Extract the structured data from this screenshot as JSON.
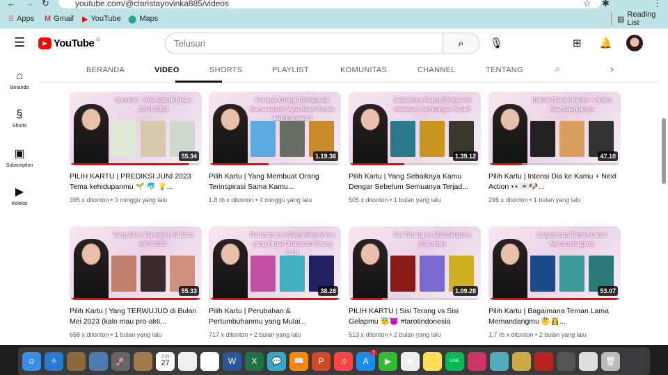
{
  "browser": {
    "url": "youtube.com/@claristayovinka885/videos",
    "bookmarks": [
      "Apps",
      "Gmail",
      "YouTube",
      "Maps"
    ],
    "reading_list": "Reading List"
  },
  "header": {
    "logo": "YouTube",
    "region": "ID",
    "search_placeholder": "Telusuri"
  },
  "sidebar": [
    {
      "label": "Beranda",
      "icon": "home-icon"
    },
    {
      "label": "Shorts",
      "icon": "shorts-icon"
    },
    {
      "label": "Subscription",
      "icon": "subscriptions-icon"
    },
    {
      "label": "Koleksi",
      "icon": "library-icon"
    }
  ],
  "tabs": [
    "BERANDA",
    "VIDEO",
    "SHORTS",
    "PLAYLIST",
    "KOMUNITAS",
    "CHANNEL",
    "TENTANG"
  ],
  "videos": [
    {
      "thumb_text": "Summer · Ada Apa di Bulan JUNI 2023",
      "duration": "55.34",
      "progress": 0.9,
      "title": "PILIH KARTU | PREDIKSI JUNI 2023 Tema kehidupanmu 🌱 🐬 💡...",
      "views": "395 x ditonton",
      "age": "3 minggu yang lalu",
      "pics": [
        "#dfe8d5",
        "#d8c8b0",
        "#cfd8cf"
      ]
    },
    {
      "thumb_text": "Kenapa Orang Terinspirasi Sama kamu? Apa Betul Sudah Jadi Inspirasi?",
      "duration": "1.19.36",
      "progress": 0.45,
      "title": "Pilih Kartu | Yang Membuat Orang Terinspirasi Sama Kamu...",
      "views": "1,8 rb x ditonton",
      "age": "4 minggu yang lalu",
      "pics": [
        "#5aa9e0",
        "#6a6f66",
        "#c88a2c"
      ]
    },
    {
      "thumb_text": "Sebaiknya Kamu Dengar Ini Sebelum Semuanya Terjadi",
      "duration": "1.39.12",
      "progress": 0.42,
      "title": "Pilih Kartu | Yang Sebaiknya Kamu Dengar Sebelum Semuanya Terjad...",
      "views": "505 x ditonton",
      "age": "1 bulan yang lalu",
      "pics": [
        "#2a7a8a",
        "#c8961e",
        "#3a3a30"
      ]
    },
    {
      "thumb_text": "Intensi Dia ke Kamu + Action Dia Selanjutnya",
      "duration": "47.10",
      "progress": 0.25,
      "title": "Pilih Kartu | Intensi Dia ke Kamu + Next Action 👀💌🐶...",
      "views": "296 x ditonton",
      "age": "1 bulan yang lalu",
      "pics": [
        "#222",
        "#d9a060",
        "#333"
      ]
    },
    {
      "thumb_text": "Yang Akan Terwujud di Bulan MEI 2023",
      "duration": "55.33",
      "progress": 1,
      "title": "Pilih Kartu | Yang TERWUJUD di Bulan Mei 2023 (kalo mau pro-akti...",
      "views": "658 x ditonton",
      "age": "1 bulan yang lalu",
      "pics": [
        "#c08070",
        "#3a2a2a",
        "#d09080"
      ]
    },
    {
      "thumb_text": "Perubahan & Pertumbuhanmu yang Mulai Dirasakan Orang Lain",
      "duration": "38.28",
      "progress": 1,
      "title": "Pilih Kartu | Perubahan & Pertumbuhanmu yang Mulai...",
      "views": "717 x ditonton",
      "age": "2 bulan yang lalu",
      "pics": [
        "#c050a0",
        "#40b0c0",
        "#202060"
      ]
    },
    {
      "thumb_text": "Sisi Terang vs Sisi Gelapmu (Shadow)",
      "duration": "1.09.28",
      "progress": 0.25,
      "title": "PILIH KARTU | Sisi Terang vs Sisi Gelapmu 😇😈 #tarotindonesia",
      "views": "513 x ditonton",
      "age": "2 bulan yang lalu",
      "pics": [
        "#8a1a1a",
        "#7a6ad0",
        "#d0b020"
      ]
    },
    {
      "thumb_text": "Bagaimana Teman Lama Memandangmu",
      "duration": "53.07",
      "progress": 1,
      "title": "Pilih Kartu | Bagaimana Teman Lama Memandangmu 🤔👸...",
      "views": "1,7 rb x ditonton",
      "age": "2 bulan yang lalu",
      "pics": [
        "#1a4a8a",
        "#3a9a9a",
        "#2a7a7a"
      ]
    }
  ],
  "dock": {
    "calendar_month": "JUN",
    "calendar_day": "27",
    "app_store_badge": "1"
  },
  "colors": {
    "accent": "#ff0000",
    "bookmark_bar": "#bfe3e6"
  }
}
